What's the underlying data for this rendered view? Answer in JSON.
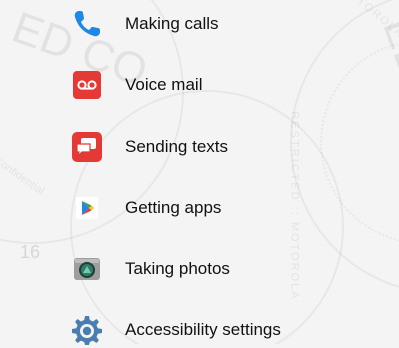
{
  "menu": {
    "items": [
      {
        "label": "Making calls",
        "icon": "phone-icon"
      },
      {
        "label": "Voice mail",
        "icon": "voicemail-icon"
      },
      {
        "label": "Sending texts",
        "icon": "message-icon"
      },
      {
        "label": "Getting apps",
        "icon": "play-store-icon"
      },
      {
        "label": "Taking photos",
        "icon": "camera-icon"
      },
      {
        "label": "Accessibility settings",
        "icon": "accessibility-gear-icon"
      }
    ]
  },
  "colors": {
    "phone_blue": "#1e88e5",
    "voicemail_red": "#e53935",
    "message_red": "#e53935",
    "camera_teal": "#2e7d6b",
    "gear_blue": "#4b7db0"
  },
  "watermark": {
    "page_number": "16"
  }
}
